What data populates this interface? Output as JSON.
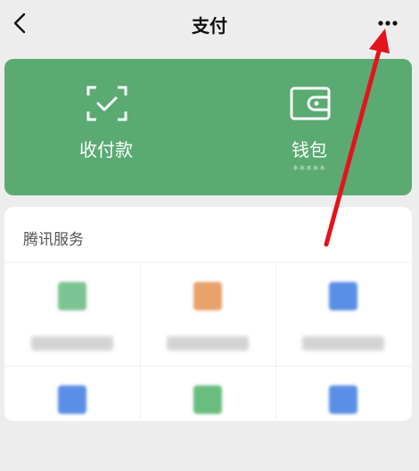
{
  "header": {
    "back_icon": "chevron-left-icon",
    "title": "支付",
    "more_icon": "more-dots-icon"
  },
  "wallet_panel": {
    "items": [
      {
        "label": "收付款",
        "icon": "scan-checkbox-icon"
      },
      {
        "label": "钱包",
        "icon": "wallet-icon",
        "sub": "*****"
      }
    ],
    "color": "#5aaa72"
  },
  "services": {
    "title": "腾讯服务",
    "tiles": [
      {
        "icon_color": "#7cc494",
        "icon": "card-icon"
      },
      {
        "icon_color": "#e9a26b",
        "icon": "phone-topup-icon"
      },
      {
        "icon_color": "#5b8fe6",
        "icon": "finance-icon"
      },
      {
        "icon_color": "#5b8fe6",
        "icon": "service-icon"
      },
      {
        "icon_color": "#69bd7e",
        "icon": "service-icon"
      },
      {
        "icon_color": "#5b8fe6",
        "icon": "service-icon"
      }
    ]
  },
  "annotation": {
    "icon": "red-arrow-icon",
    "color": "#e3141b"
  }
}
